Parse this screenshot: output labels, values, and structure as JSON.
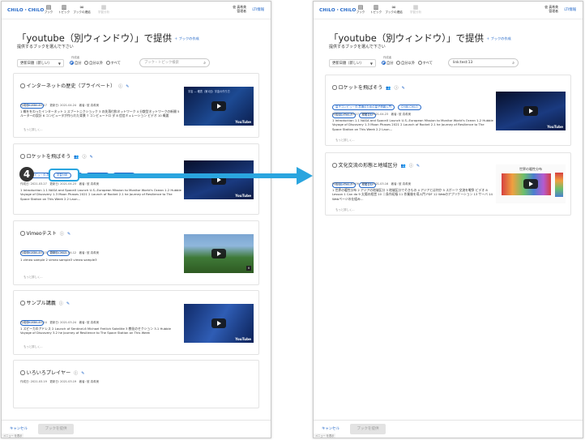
{
  "app": {
    "logo": "CHiLO・CHiLO",
    "nav": [
      {
        "icon": "▤",
        "label": "ブック"
      },
      {
        "icon": "▥",
        "label": "トピック"
      },
      {
        "icon": "∞",
        "label": "ブックの連結"
      },
      {
        "icon": "▦",
        "label": "学習分析"
      }
    ],
    "user_name": "彼 真希美",
    "user_role": "管理者",
    "lti_label": "LTI情報"
  },
  "page": {
    "title": "「youtube（別ウィンドウ）」で提供",
    "add_book": "ブックの作成",
    "subtitle": "提供するブックを選んで下さい"
  },
  "filters": {
    "sort_value": "更新日順（新しい）",
    "creator_label": "作成者",
    "opt_self": "自分",
    "opt_others": "自分以外",
    "opt_all": "すべて",
    "search_placeholder": "ブック・トピック検索",
    "search_value_right": "link:test:13"
  },
  "colors": {
    "accent": "#2166c8",
    "highlight": "#2aa5df"
  },
  "left_cards": [
    {
      "title": "インターネットの歴史（プライベート）",
      "tags": [
        "CHiBi-CHiLO"
      ],
      "meta": "作成日: 2021.03.17　更新日: 2021.04.24　著者: 彼 真希美",
      "desc": "1 概ををわったインターネット 2 スプートニクショック 3 の失落付和ネットワーク 4 分散型ネットワークの新開 5 ルーターの設計 6 コンピュータが作られた背景 7 コンピュートロ ダ 8 信信ミュレーション ビデオ 10 概要",
      "more": "もっと詳しく..."
    },
    {
      "title": "ロケットを飛ばそう",
      "tags": [
        "量子コンピュータ:意識のための量子情報入門",
        "CHiBi-CHiLO",
        "CHiBi-CHiLO",
        "学習分析"
      ],
      "meta": "作成日: 2021.03.27　更新日: 2021.04.23　著者: 彼 真希美",
      "desc": "1 Introduction 1.1 NASA and SpaceX Launch U.S.-European Mission to Monitor World's Ocean 1.2 Hubble Voyage of Discovery 1.3 Moon Phases 2021 2 Launch of Rocket 2.1 he Journey of Resilience to The Space Station on This Week 2.2 Laun…",
      "more": "もっと詳しく..."
    },
    {
      "title": "Vimeoテスト",
      "tags": [
        "CHiBi-CHiLO",
        "CHiBi-CHiLO"
      ],
      "meta": "作成日: 2021.03.23　更新日: 2021.04.12　著者: 彼 真希美",
      "desc": "1 vimeo sample 2 vimeo sample3 vimeo sample3",
      "more": "もっと詳しく..."
    },
    {
      "title": "サンプル講義",
      "tags": [
        "CHiBi-CHiLO"
      ],
      "meta": "作成日: 2021.03.24　更新日: 2021.03.24　著者: 彼 真希美",
      "desc": "1 スピーカのアドレス 2 Launch of Sentinel-6 Michael Freilich Satellite 3 教化のセクション 3.1 Hubble Voyage of Discovery 3.2 he Journey of Resilience to The Space Station on This Week",
      "more": "もっと詳しく..."
    },
    {
      "title": "いろいろプレイヤー",
      "tags": [],
      "meta": "作成日: 2021.03.19　更新日: 2021.03.19　著者: 彼 真希美",
      "desc": "",
      "more": ""
    }
  ],
  "right_cards": [
    {
      "title": "ロケットを飛ばそう",
      "tags": [
        "量子コンピュータ:意識のための量子情報入門",
        "CHiBi-CHiLO",
        "CHiBi-CHiLO",
        "学習分析"
      ],
      "meta": "作成日: 2021.03.27　更新日: 2021.04.23　著者: 彼 真希美",
      "desc": "1 Introduction 1.1 NASA and SpaceX Launch U.S.-European Mission to Monitor World's Ocean 1.2 Hubble Voyage of Discovery 1.3 Moon Phases 2021 2 Launch of Rocket 2.1 he Journey of Resilience to The Space Station on This Week 2.2 Laun…",
      "more": "もっと詳しく..."
    },
    {
      "title": "文化交流の形態と地域区分",
      "tags": [
        "CHiBi-CHiLO",
        "学習分析"
      ],
      "meta": "作成日: 2021.03.09　更新日: 2021.03.16　著者: 彼 真希美",
      "desc": "1 世界の暖性分布 2 アジアの地域区分 3 地域区分でそきもの 4 アジアとは何か 5 スポーツ 交流を戦争 ビデオ 8 Lesson 1 Can do 9 太陽の経営 10 二条作初級 11 作業後を導入門 PDF 12 Webのアプリケーション 13 サーバ 14 Webページの仕組み…",
      "more": "もっと詳しく..."
    }
  ],
  "thumb_texts": {
    "youtube": "YouTube",
    "map_title": "世界の暖性分布",
    "vimeo_mark": "v",
    "space_caption": "宇宙 — 確表（第1回）宇宙の作り方"
  },
  "footer": {
    "cancel": "キャンセル",
    "provide": "ブックを提供",
    "menu_badge": "メニュー を表示"
  },
  "callout": {
    "number": "4",
    "tag": "学習分析"
  }
}
